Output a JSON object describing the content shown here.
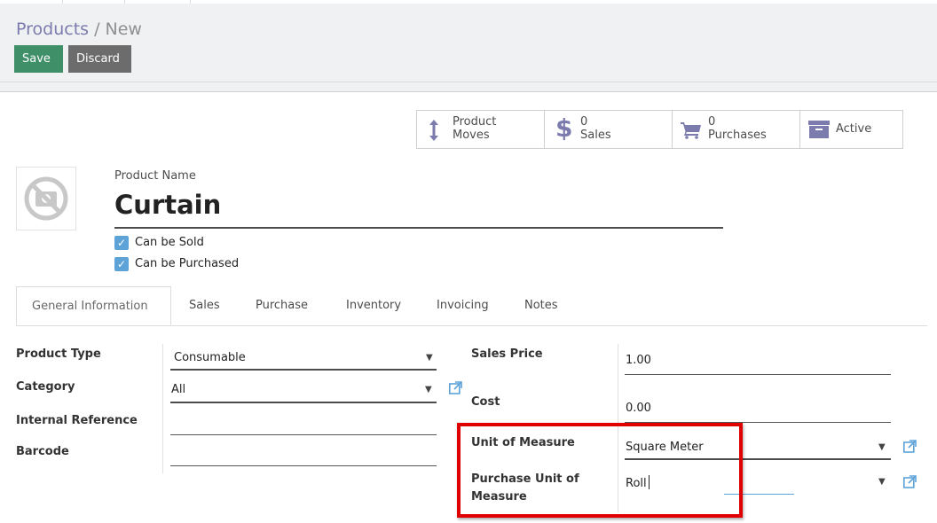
{
  "breadcrumb": {
    "parent": "Products",
    "separator": " / ",
    "current": "New"
  },
  "buttons": {
    "save": "Save",
    "discard": "Discard"
  },
  "stats": {
    "moves": {
      "line1": "Product",
      "line2": "Moves"
    },
    "sales": {
      "count": "0",
      "label": "Sales"
    },
    "purchases": {
      "count": "0",
      "label": "Purchases"
    },
    "active": {
      "label": "Active"
    }
  },
  "product": {
    "name_label": "Product Name",
    "name": "Curtain",
    "can_be_sold": "Can be Sold",
    "can_be_purchased": "Can be Purchased"
  },
  "tabs": [
    "General Information",
    "Sales",
    "Purchase",
    "Inventory",
    "Invoicing",
    "Notes"
  ],
  "left_fields": {
    "product_type": {
      "label": "Product Type",
      "value": "Consumable"
    },
    "category": {
      "label": "Category",
      "value": "All"
    },
    "internal_reference": {
      "label": "Internal Reference",
      "value": ""
    },
    "barcode": {
      "label": "Barcode",
      "value": ""
    }
  },
  "right_fields": {
    "sales_price": {
      "label": "Sales Price",
      "value": "1.00"
    },
    "cost": {
      "label": "Cost",
      "value": "0.00"
    },
    "uom": {
      "label": "Unit of Measure",
      "value": "Square Meter"
    },
    "purchase_uom": {
      "label_line1": "Purchase Unit of",
      "label_line2": "Measure",
      "value": "Roll"
    }
  },
  "colors": {
    "accent": "#7c7bad",
    "save": "#3f8f68",
    "discard": "#6c6c6c",
    "highlight": "#e00000",
    "checkbox": "#5da3d8"
  }
}
